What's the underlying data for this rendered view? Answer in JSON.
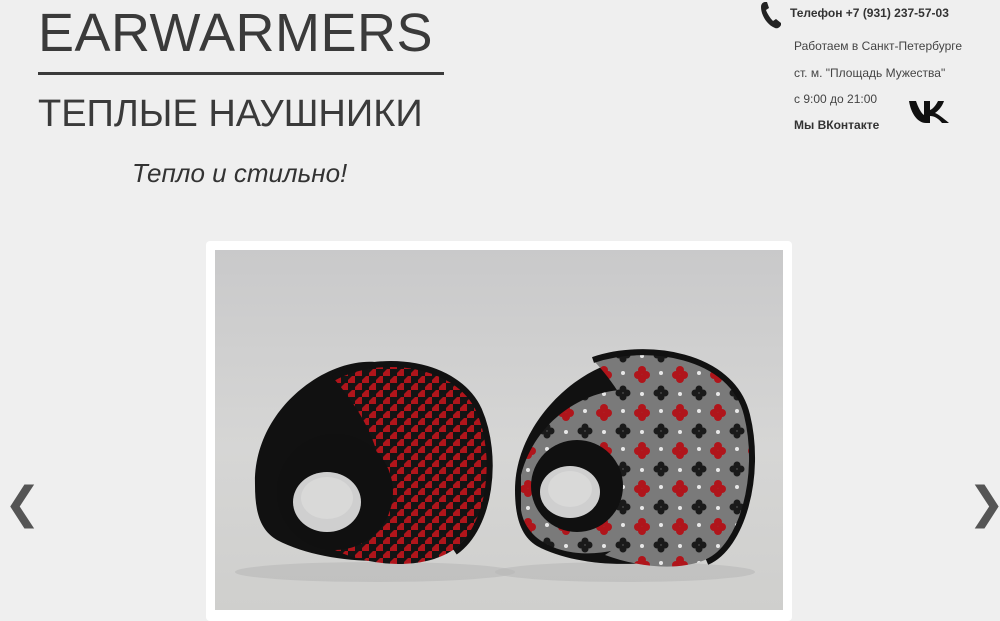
{
  "logo": {
    "title": "EARWARMERS",
    "subtitle": "ТЕПЛЫЕ НАУШНИКИ"
  },
  "slogan": "Тепло и стильно!",
  "contacts": {
    "phone": "Телефон +7 (931) 237-57-03",
    "city": "Работаем в Санкт-Петербурге",
    "metro": "ст. м. \"Площадь Мужества\"",
    "hours": "с 9:00 до 21:00",
    "vk_label": "Мы ВКонтакте",
    "phone_icon": "phone-icon",
    "vk_icon": "vk-logo-icon"
  },
  "slider": {
    "prev_label": "❮",
    "next_label": "❯",
    "slide_image": "earmuffs-photo",
    "colors": {
      "accent_red": "#b0151b",
      "fabric_black": "#141414",
      "fabric_gray": "#7a7a7a"
    }
  }
}
